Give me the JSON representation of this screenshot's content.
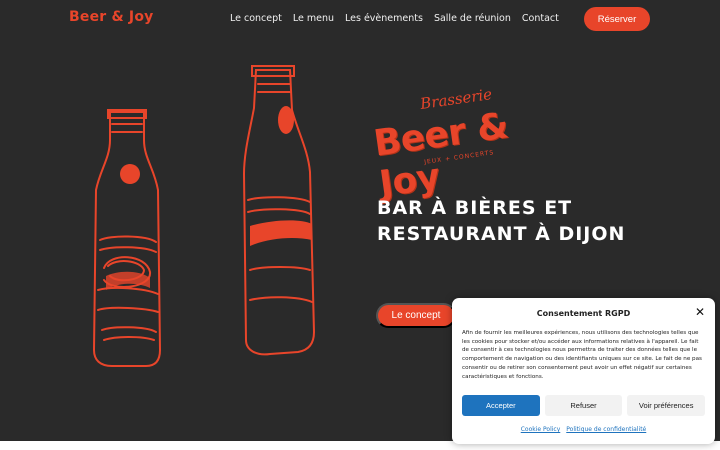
{
  "header": {
    "logo": "Beer & Joy",
    "nav": [
      "Le concept",
      "Le menu",
      "Les évènements",
      "Salle de réunion",
      "Contact"
    ],
    "reserve_label": "Réserver"
  },
  "hero": {
    "brand_top": "Brasserie",
    "brand_name": "Beer & Joy",
    "brand_sub": "JEUX + CONCERTS",
    "tagline_line1": "BAR À BIÈRES ET",
    "tagline_line2": "RESTAURANT À DIJON",
    "cta_label": "Le concept"
  },
  "cookie_banner": {
    "title": "Consentement RGPD",
    "text": "Afin de fournir les meilleures expériences, nous utilisons des technologies telles que les cookies pour stocker et/ou accéder aux informations relatives à l'appareil. Le fait de consentir à ces technologies nous permettra de traiter des données telles que le comportement de navigation ou des identifiants uniques sur ce site. Le fait de ne pas consentir ou de retirer son consentement peut avoir un effet négatif sur certaines caractéristiques et fonctions.",
    "accept_label": "Accepter",
    "refuse_label": "Refuser",
    "prefs_label": "Voir préférences",
    "link_cookie": "Cookie Policy",
    "link_privacy": "Politique de confidentialité"
  },
  "colors": {
    "accent": "#e8452a",
    "background": "#2a2a2a",
    "accept_button": "#1e73be"
  }
}
